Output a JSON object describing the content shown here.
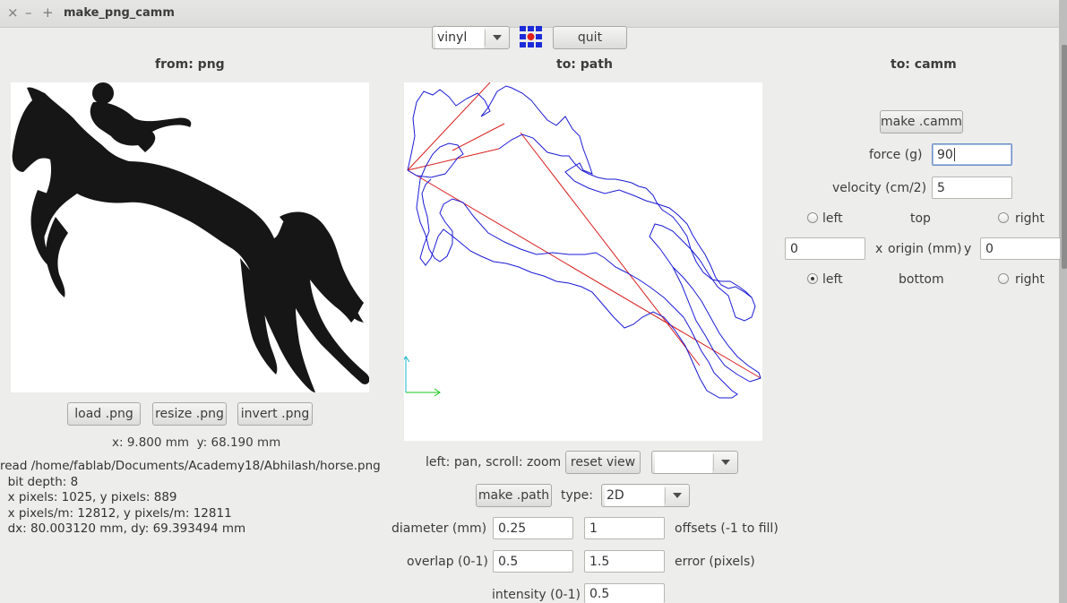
{
  "window": {
    "title": "make_png_camm",
    "controls": [
      "×",
      "–",
      "+"
    ]
  },
  "toolbar": {
    "machine_select": "vinyl",
    "logo_icon": "grid-logo-icon",
    "quit_label": "quit"
  },
  "png_panel": {
    "heading": "from: png",
    "image_icon": "horse-silhouette-icon",
    "load_label": "load .png",
    "resize_label": "resize .png",
    "invert_label": "invert .png",
    "coords": "x: 9.800 mm  y: 68.190 mm",
    "info_lines": [
      "read /home/fablab/Documents/Academy18/Abhilash/horse.png",
      "  bit depth: 8",
      "  x pixels: 1025, y pixels: 889",
      "  x pixels/m: 12812, y pixels/m: 12811",
      "  dx: 80.003120 mm, dy: 69.393494 mm"
    ]
  },
  "path_panel": {
    "heading": "to: path",
    "hint": "left: pan, scroll: zoom",
    "reset_label": "reset view",
    "view_select": "",
    "make_label": "make .path",
    "type_label": "type:",
    "type_select": "2D",
    "diameter_label": "diameter (mm)",
    "diameter_value": "0.25",
    "offsets_value": "1",
    "offsets_label": "offsets (-1 to fill)",
    "overlap_label": "overlap (0-1)",
    "overlap_value": "0.5",
    "error_value": "1.5",
    "error_label": "error (pixels)",
    "intensity_label": "intensity (0-1)",
    "intensity_value": "0.5",
    "colors": {
      "toolpath": "#1a1ad6",
      "rapid": "#d81e1e",
      "x_axis": "#17c717",
      "y_axis": "#17b5c9"
    }
  },
  "camm_panel": {
    "heading": "to: camm",
    "make_label": "make .camm",
    "force_label": "force (g)",
    "force_value": "90",
    "velocity_label": "velocity (cm/2)",
    "velocity_value": "5",
    "top_label": "top",
    "bottom_label": "bottom",
    "left_label": "left",
    "right_label": "right",
    "x_label": "x",
    "origin_label": "origin (mm)",
    "y_label": "y",
    "origin_x_value": "0",
    "origin_y_value": "0",
    "origin_selected": "bottom-left"
  }
}
